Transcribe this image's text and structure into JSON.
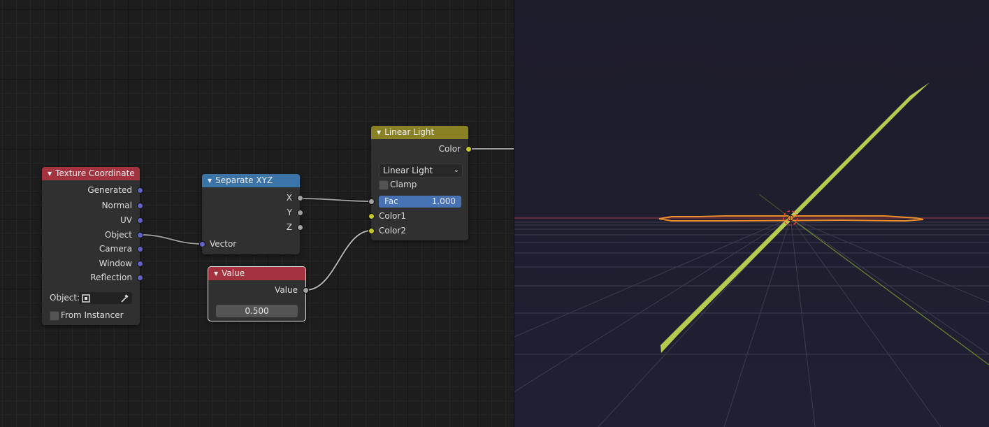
{
  "colors": {
    "texture_coordinate_header": "#a5323f",
    "separate_xyz_header": "#3a74a8",
    "linear_light_header": "#8a8124",
    "value_header": "#a5323f",
    "vector_socket": "#6363c7",
    "float_socket": "#a1a1a1",
    "color_socket": "#c7c729",
    "fac_slider": "#4772b3",
    "viewport_bg": "#1d1c2b",
    "selection_orange": "#f0902b",
    "plane_green": "#b4cc4f"
  },
  "nodes": {
    "texture_coordinate": {
      "title": "Texture Coordinate",
      "outputs": [
        "Generated",
        "Normal",
        "UV",
        "Object",
        "Camera",
        "Window",
        "Reflection"
      ],
      "object_label": "Object:",
      "from_instancer_label": "From Instancer",
      "from_instancer_checked": false
    },
    "separate_xyz": {
      "title": "Separate XYZ",
      "outputs": [
        "X",
        "Y",
        "Z"
      ],
      "input": "Vector"
    },
    "value": {
      "title": "Value",
      "output": "Value",
      "value": "0.500"
    },
    "linear_light": {
      "title": "Linear Light",
      "output": "Color",
      "blend_mode": "Linear Light",
      "clamp_label": "Clamp",
      "clamp_checked": false,
      "fac_label": "Fac",
      "fac_value": "1.000",
      "fac_fraction": 1.0,
      "inputs": [
        "Color1",
        "Color2"
      ]
    }
  },
  "icons": {
    "collapse": "▼",
    "dropdown": "chevron-down-icon",
    "eyedropper": "eyedropper-icon",
    "object": "object-icon"
  }
}
